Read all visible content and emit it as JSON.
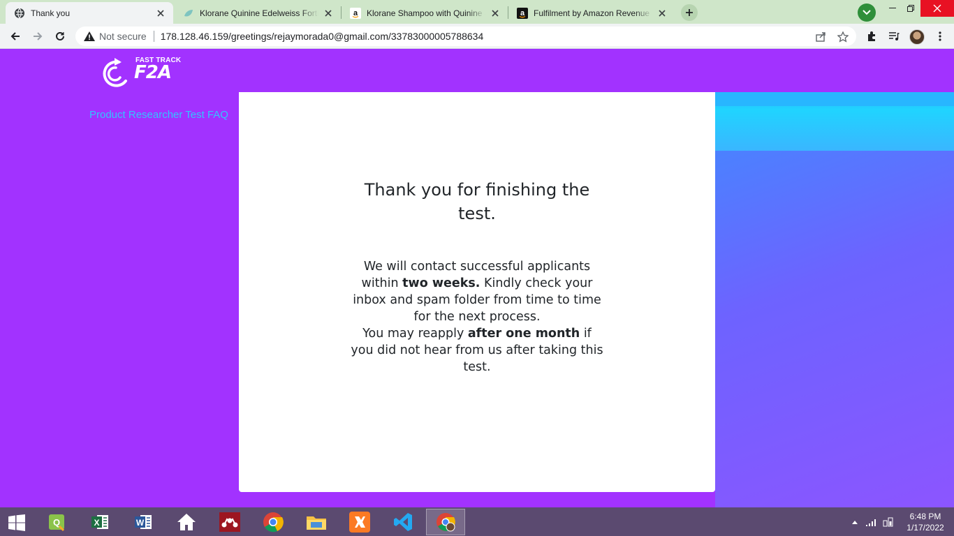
{
  "browser": {
    "tabs": [
      {
        "title": "Thank you",
        "favicon": "globe-icon",
        "active": true
      },
      {
        "title": "Klorane Quinine Edelweiss Fortifying Shampoo",
        "favicon": "leaf-icon",
        "active": false
      },
      {
        "title": "Klorane Shampoo with Quinine and Edelweiss",
        "favicon": "amazon-icon",
        "active": false
      },
      {
        "title": "Fulfilment by Amazon Revenue Calculator",
        "favicon": "amazon-icon",
        "active": false
      }
    ],
    "security_label": "Not secure",
    "url": "178.128.46.159/greetings/rejaymorada0@gmail.com/33783000005788634"
  },
  "site": {
    "logo_top": "FAST TRACK",
    "logo_bottom": "F2A",
    "faq_link": "Product Researcher Test FAQ"
  },
  "card": {
    "heading": "Thank you for finishing the test.",
    "message_part1": "We will contact successful applicants within ",
    "message_bold1": "two weeks.",
    "message_part2": " Kindly check your inbox and spam folder from time to time for the next process.",
    "message_part3": "You may reapply ",
    "message_bold2": "after one month",
    "message_part4": " if you did not hear from us after taking this test."
  },
  "taskbar": {
    "apps": [
      "windows-start-icon",
      "qgis-icon",
      "excel-icon",
      "word-icon",
      "home-icon",
      "mendeley-icon",
      "chrome-icon",
      "file-explorer-icon",
      "xampp-icon",
      "vscode-icon",
      "chrome-profile-icon"
    ],
    "time": "6:48 PM",
    "date": "1/17/2022"
  },
  "colors": {
    "page_bg": "#a232ff",
    "link": "#32c5ff",
    "tabstrip": "#cfe6c9",
    "taskbar": "#5b4a70"
  }
}
